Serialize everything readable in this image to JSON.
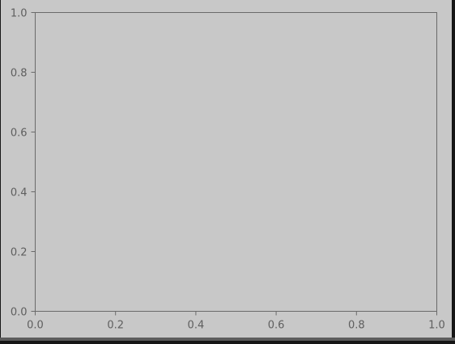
{
  "colors": {
    "figure_background": "#c8c8c8",
    "axes_background": "#c8c8c8",
    "frame": "#6a6a6a",
    "tick_label": "#5e5e5e",
    "window_border": "#161616",
    "bottom_strip": "#5c5c5c"
  },
  "chart_data": {
    "type": "line",
    "title": "",
    "xlabel": "",
    "ylabel": "",
    "xlim": [
      0,
      1
    ],
    "ylim": [
      0,
      1
    ],
    "grid": false,
    "series": [],
    "xticks": [
      {
        "value": 0.0,
        "label": "0.0"
      },
      {
        "value": 0.2,
        "label": "0.2"
      },
      {
        "value": 0.4,
        "label": "0.4"
      },
      {
        "value": 0.6,
        "label": "0.6"
      },
      {
        "value": 0.8,
        "label": "0.8"
      },
      {
        "value": 1.0,
        "label": "1.0"
      }
    ],
    "yticks": [
      {
        "value": 0.0,
        "label": "0.0"
      },
      {
        "value": 0.2,
        "label": "0.2"
      },
      {
        "value": 0.4,
        "label": "0.4"
      },
      {
        "value": 0.6,
        "label": "0.6"
      },
      {
        "value": 0.8,
        "label": "0.8"
      },
      {
        "value": 1.0,
        "label": "1.0"
      }
    ]
  }
}
